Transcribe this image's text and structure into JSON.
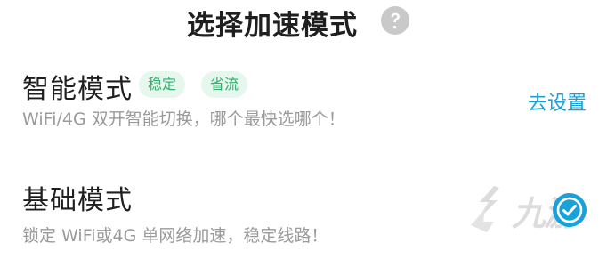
{
  "header": {
    "title": "选择加速模式",
    "help_icon": "question-circle-icon"
  },
  "modes": [
    {
      "title": "智能模式",
      "badges": [
        "稳定",
        "省流"
      ],
      "description": "WiFi/4G 双开智能切换，哪个最快选哪个！",
      "action_label": "去设置"
    },
    {
      "title": "基础模式",
      "description": "锁定 WiFi或4G 单网络加速，稳定线路！",
      "selected": true,
      "selected_icon": "check-circle-icon"
    }
  ],
  "watermark": {
    "text": "九游",
    "icon": "nine-game-logo-icon"
  },
  "colors": {
    "accent": "#1aa1d8",
    "badge_text": "#2fae6a",
    "badge_bg": "#e6f7ee",
    "desc_text": "#9a9a9a"
  }
}
